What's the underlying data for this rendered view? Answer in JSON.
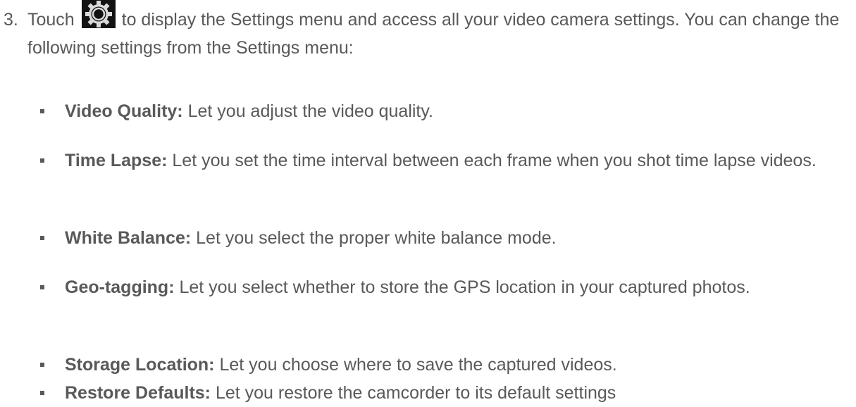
{
  "step": {
    "number": "3.",
    "before_icon": "Touch",
    "icon": "gear-icon",
    "after_icon": "to display the Settings menu and access all your video camera settings. You can change the following settings from the Settings menu:"
  },
  "settings": [
    {
      "term": "Video Quality:",
      "description": "Let you adjust the video quality."
    },
    {
      "term": "Time Lapse:",
      "description": "Let you set the time interval between each frame when you shot time lapse videos."
    },
    {
      "term": "White Balance:",
      "description": "Let you select the proper white balance mode."
    },
    {
      "term": "Geo-tagging:",
      "description": "Let you select whether to store the GPS location in your captured photos."
    },
    {
      "term": "Storage Location:",
      "description": "Let you choose where to save the captured videos."
    },
    {
      "term": "Restore Defaults:",
      "description": "Let you restore the camcorder to its default settings"
    }
  ]
}
